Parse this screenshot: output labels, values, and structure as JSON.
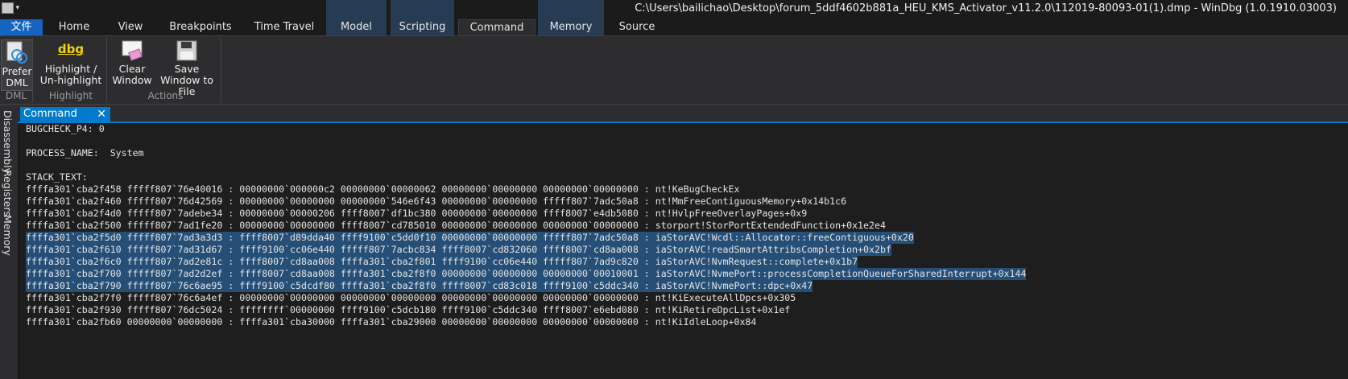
{
  "window": {
    "title": "C:\\Users\\bailichao\\Desktop\\forum_5ddf4602b881a_HEU_KMS_Activator_v11.2.0\\112019-80093-01(1).dmp - WinDbg (1.0.1910.03003)"
  },
  "tabs": [
    {
      "label": "文件"
    },
    {
      "label": "Home"
    },
    {
      "label": "View"
    },
    {
      "label": "Breakpoints"
    },
    {
      "label": "Time Travel"
    },
    {
      "label": "Model"
    },
    {
      "label": "Scripting"
    },
    {
      "label": "Command"
    },
    {
      "label": "Memory"
    },
    {
      "label": "Source"
    }
  ],
  "ribbon": {
    "prefer_dml": "Prefer DML",
    "highlight_icon_text": "dbg",
    "highlight": "Highlight / Un-highlight",
    "clear_window": "Clear Window",
    "save_window": "Save Window to File",
    "groups": {
      "dml": "DML",
      "highlight": "Highlight",
      "actions": "Actions"
    }
  },
  "side_tabs": [
    "Disassembly",
    "Registers",
    "Memory"
  ],
  "document": {
    "tab_label": "Command",
    "close": "✕"
  },
  "output_lines": [
    "BUGCHECK_P4: 0",
    "",
    "PROCESS_NAME:  System",
    "",
    "STACK_TEXT:",
    "ffffa301`cba2f458 fffff807`76e40016 : 00000000`000000c2 00000000`00000062 00000000`00000000 00000000`00000000 : nt!KeBugCheckEx",
    "ffffa301`cba2f460 fffff807`76d42569 : 00000000`00000000 00000000`546e6f43 00000000`00000000 fffff807`7adc50a8 : nt!MmFreeContiguousMemory+0x14b1c6",
    "ffffa301`cba2f4d0 fffff807`7adebe34 : 00000000`00000206 ffff8007`df1bc380 00000000`00000000 ffff8007`e4db5080 : nt!HvlpFreeOverlayPages+0x9",
    "ffffa301`cba2f500 fffff807`7ad1fe20 : 00000000`00000000 ffff8007`cd785010 00000000`00000000 00000000`00000000 : storport!StorPortExtendedFunction+0x1e2e4",
    "ffffa301`cba2f5d0 fffff807`7ad3a3d3 : ffff8007`d89dda40 ffff9100`c5dd0f10 00000000`00000000 fffff807`7adc50a8 : iaStorAVC!Wcdl::Allocator::freeContiguous+0x20",
    "ffffa301`cba2f610 fffff807`7ad31d67 : ffff9100`cc06e440 fffff807`7acbc834 ffff8007`cd832060 ffff8007`cd8aa008 : iaStorAVC!readSmartAttribsCompletion+0x2bf",
    "ffffa301`cba2f6c0 fffff807`7ad2e81c : ffff8007`cd8aa008 ffffa301`cba2f801 ffff9100`cc06e440 fffff807`7ad9c820 : iaStorAVC!NvmRequest::complete+0x1b7",
    "ffffa301`cba2f700 fffff807`7ad2d2ef : ffff8007`cd8aa008 ffffa301`cba2f8f0 00000000`00000000 00000000`00010001 : iaStorAVC!NvmePort::processCompletionQueueForSharedInterrupt+0x144",
    "ffffa301`cba2f790 fffff807`76c6ae95 : ffff9100`c5dcdf80 ffffa301`cba2f8f0 ffff8007`cd83c018 ffff9100`c5ddc340 : iaStorAVC!NvmePort::dpc+0x47",
    "ffffa301`cba2f7f0 fffff807`76c6a4ef : 00000000`00000000 00000000`00000000 00000000`00000000 00000000`00000000 : nt!KiExecuteAllDpcs+0x305",
    "ffffa301`cba2f930 fffff807`76dc5024 : ffffffff`00000000 ffff9100`c5dcb180 ffff9100`c5ddc340 ffff8007`e6ebd080 : nt!KiRetireDpcList+0x1ef",
    "ffffa301`cba2fb60 00000000`00000000 : ffffa301`cba30000 ffffa301`cba29000 00000000`00000000 00000000`00000000 : nt!KiIdleLoop+0x84"
  ],
  "colors": {
    "file_tab": "#1565c0",
    "debug_tab_accent": "#273b52",
    "selection": "#264f78",
    "doc_tab": "#007acc"
  }
}
